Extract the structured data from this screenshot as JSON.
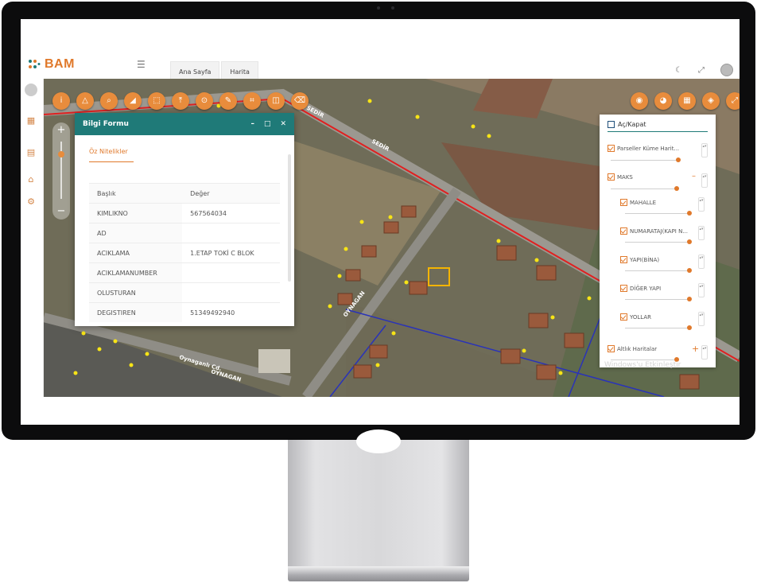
{
  "app": {
    "logo_text": "BAM",
    "tabs": [
      {
        "label": "Ana Sayfa"
      },
      {
        "label": "Harita"
      }
    ]
  },
  "map": {
    "street_labels": [
      "SEDİR",
      "SEDİR",
      "OYNAGAN",
      "Oynaganlı Cd.",
      "OYNAGAN"
    ]
  },
  "info_form": {
    "title": "Bilgi Formu",
    "tab_label": "Öz Nitelikler",
    "header": {
      "key": "Başlık",
      "value": "Değer"
    },
    "rows": [
      {
        "key": "KIMLIKNO",
        "value": "567564034"
      },
      {
        "key": "AD",
        "value": ""
      },
      {
        "key": "ACIKLAMA",
        "value": "1.ETAP TOKİ C BLOK"
      },
      {
        "key": "ACIKLAMANUMBER",
        "value": ""
      },
      {
        "key": "OLUSTURAN",
        "value": ""
      },
      {
        "key": "DEGISTIREN",
        "value": "51349492940"
      }
    ]
  },
  "layer_panel": {
    "toggle_label": "Aç/Kapat",
    "layers": [
      {
        "label": "Parseller Küme Harit...",
        "checked": true
      },
      {
        "label": "MAKS",
        "checked": true
      },
      {
        "label": "MAHALLE",
        "checked": true
      },
      {
        "label": "NUMARATAJ(KAPI N...",
        "checked": true
      },
      {
        "label": "YAPI(BİNA)",
        "checked": true
      },
      {
        "label": "DİĞER YAPI",
        "checked": true
      },
      {
        "label": "YOLLAR",
        "checked": true
      },
      {
        "label": "Altlık Haritalar",
        "checked": true
      }
    ],
    "watermark": "Windows'u Etkinleştir"
  },
  "colors": {
    "accent": "#e0792b",
    "form_header": "#1f7a78",
    "parcel_line": "#e02020",
    "boundary_line": "#2a33b8"
  }
}
